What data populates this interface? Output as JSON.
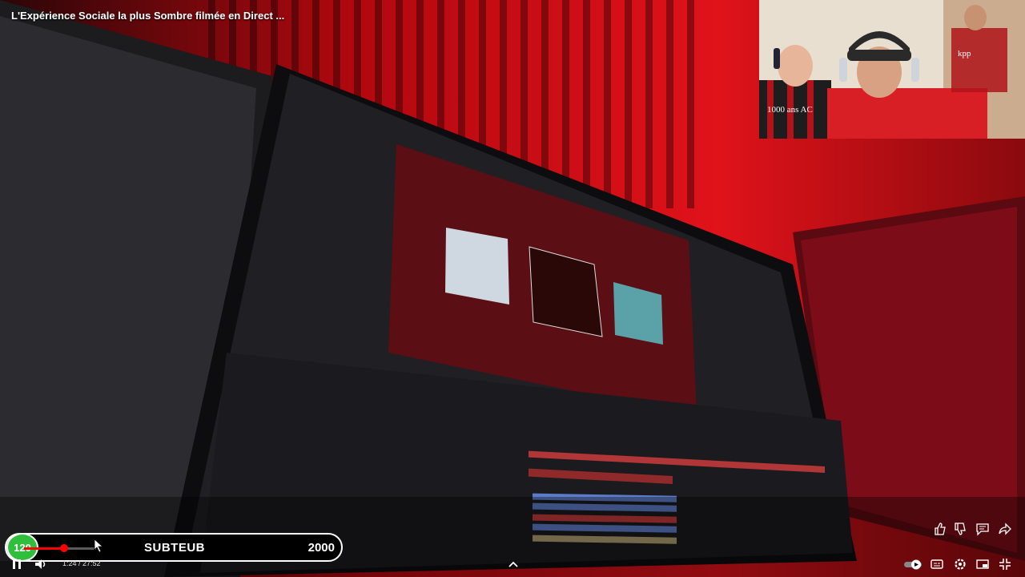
{
  "video": {
    "title": "L'Expérience Sociale la plus Sombre filmée en Direct ..."
  },
  "webcam": {
    "jersey_text": "1000 ans AC",
    "mural_text": "kpp"
  },
  "subgoal": {
    "current": "120",
    "label": "SUBTEUB",
    "goal": "2000"
  },
  "player": {
    "time": "1:24 / 27:52",
    "progress_fraction": 0.56,
    "accent_color": "#ff0000"
  },
  "icons": {
    "pause": "pause-icon",
    "volume": "volume-icon",
    "like": "thumbs-up-icon",
    "dislike": "thumbs-down-icon",
    "comments": "comment-icon",
    "share": "share-icon",
    "autoplay": "autoplay-toggle-icon",
    "captions": "subtitles-icon",
    "settings": "gear-icon",
    "miniplayer": "miniplayer-icon",
    "cast": "cast-icon",
    "exit_fullscreen": "exit-fullscreen-icon"
  }
}
